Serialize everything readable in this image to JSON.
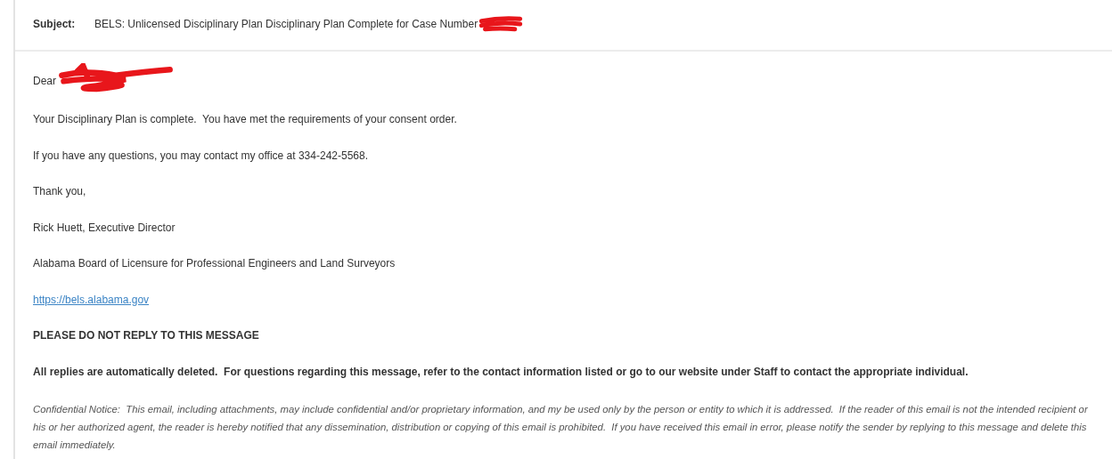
{
  "header": {
    "subject_label": "Subject:",
    "subject": "BELS: Unlicensed Disciplinary Plan Disciplinary Plan Complete for Case Number"
  },
  "body": {
    "greeting": "Dear",
    "paragraphs": [
      {
        "kind": "plain",
        "text": "Your Disciplinary Plan is complete.  You have met the requirements of your consent order."
      },
      {
        "kind": "plain",
        "text": "If you have any questions, you may contact my office at 334-242-5568."
      },
      {
        "kind": "plain",
        "text": "Thank you,"
      },
      {
        "kind": "plain",
        "text": "Rick Huett, Executive Director"
      },
      {
        "kind": "plain",
        "text": "Alabama Board of Licensure for Professional Engineers and Land Surveyors"
      },
      {
        "kind": "link",
        "text": "https://bels.alabama.gov"
      },
      {
        "kind": "bold",
        "text": "PLEASE DO NOT REPLY TO THIS MESSAGE"
      },
      {
        "kind": "bold",
        "text": "All replies are automatically deleted.  For questions regarding this message, refer to the contact information listed or go to our website under Staff to contact the appropriate individual."
      },
      {
        "kind": "notice",
        "text": "Confidential Notice:  This email, including attachments, may include confidential and/or proprietary information, and my be used only by the person or entity to which it is addressed.  If the reader of this email is not the intended recipient or his or her authorized agent, the reader is hereby notified that any dissemination, distribution or copying of this email is prohibited.  If you have received this email in error, please notify the sender by replying to this message and delete this email immediately."
      }
    ]
  }
}
